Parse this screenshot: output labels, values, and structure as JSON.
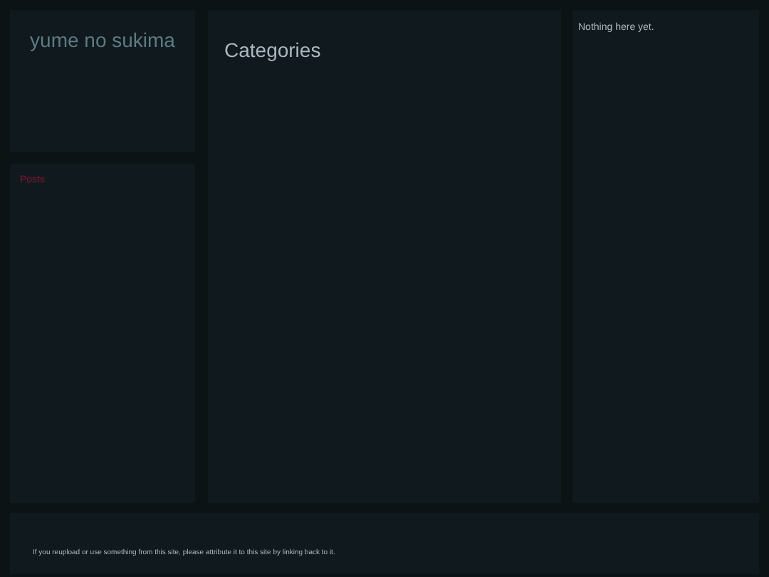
{
  "site_title": "yume no sukima",
  "sidebar": {
    "links": [
      {
        "label": "Posts"
      }
    ]
  },
  "main": {
    "heading": "Categories"
  },
  "aside": {
    "text": "Nothing here yet."
  },
  "footer": {
    "text": "If you reupload or use something from this site, please attribute it to this site by linking back to it."
  }
}
